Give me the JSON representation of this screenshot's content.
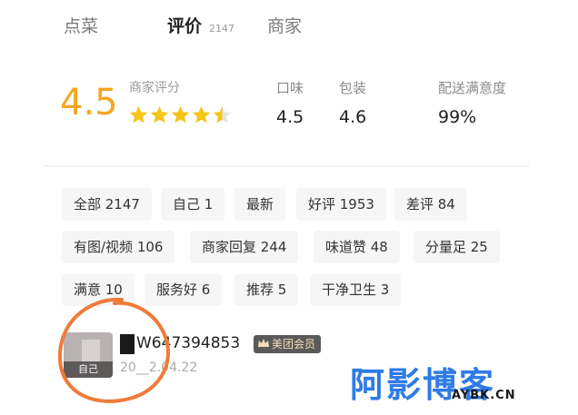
{
  "tabs": [
    {
      "label": "点菜",
      "active": false
    },
    {
      "label": "评价",
      "active": true,
      "count": "2147"
    },
    {
      "label": "商家",
      "active": false
    }
  ],
  "summary": {
    "score": "4.5",
    "merchant_label": "商家评分",
    "stars": 4.5,
    "taste": {
      "label": "口味",
      "value": "4.5"
    },
    "packaging": {
      "label": "包装",
      "value": "4.6"
    },
    "delivery": {
      "label": "配送满意度",
      "value": "99%"
    }
  },
  "tags": [
    {
      "label": "全部 2147",
      "active": true
    },
    {
      "label": "自己 1"
    },
    {
      "label": "最新"
    },
    {
      "label": "好评 1953"
    },
    {
      "label": "差评 84"
    },
    {
      "label": "有图/视频 106"
    },
    {
      "label": "商家回复 244"
    },
    {
      "label": "味道赞 48"
    },
    {
      "label": "分量足 25"
    },
    {
      "label": "满意 10"
    },
    {
      "label": "服务好 6"
    },
    {
      "label": "推荐 5"
    },
    {
      "label": "干净卫生 3"
    }
  ],
  "review": {
    "avatar_label": "自己",
    "username": "W647394853",
    "badge": "美团会员",
    "date": "20__2.04.22"
  },
  "watermark": {
    "text": "阿影博客",
    "domain": "AYBK.CN"
  },
  "colors": {
    "accent": "#f5a623",
    "active_tag": "#fbd33f",
    "circle": "#f07a3a",
    "watermark": "#2f7be6"
  }
}
